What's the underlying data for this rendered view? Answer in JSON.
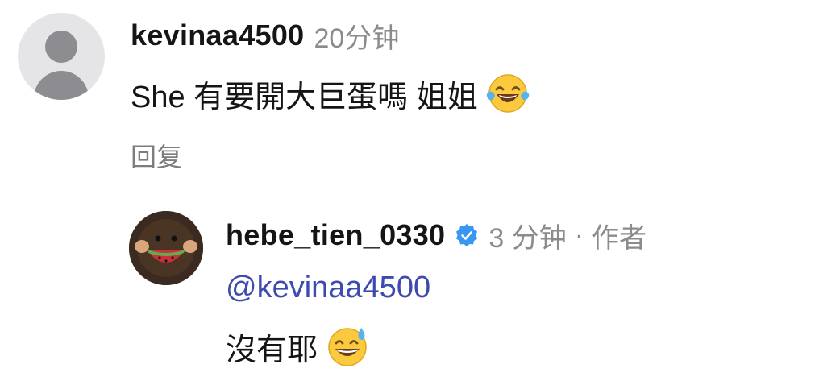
{
  "comment": {
    "username": "kevinaa4500",
    "time": "20分钟",
    "text": "She 有要開大巨蛋嗎 姐姐",
    "emoji_icon": "laughing-tears-emoji-icon",
    "reply_label": "回复"
  },
  "reply": {
    "username": "hebe_tien_0330",
    "verified_icon": "verified-badge-icon",
    "time": "3 分钟",
    "separator": "·",
    "role": "作者",
    "mention": "@kevinaa4500",
    "text": "沒有耶",
    "emoji_icon": "sweat-smile-emoji-icon"
  },
  "colors": {
    "username": "#151515",
    "meta_gray": "#8b8b8b",
    "mention_blue": "#3d4bb0",
    "verified_blue": "#3897f0",
    "avatar_placeholder": "#8d8d91"
  }
}
